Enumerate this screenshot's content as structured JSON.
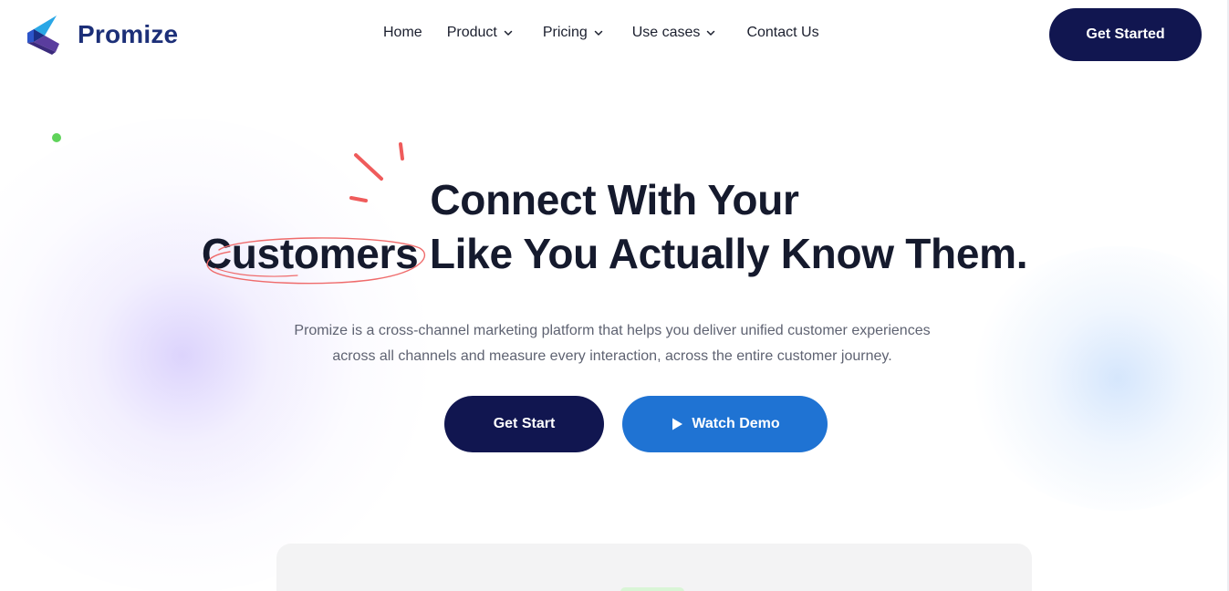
{
  "brand": {
    "name": "Promize",
    "color": "#1c2f78"
  },
  "nav": {
    "items": [
      {
        "label": "Home",
        "dropdown": false
      },
      {
        "label": "Product",
        "dropdown": true
      },
      {
        "label": "Pricing",
        "dropdown": true
      },
      {
        "label": "Use cases",
        "dropdown": true
      },
      {
        "label": "Contact Us",
        "dropdown": false
      }
    ],
    "cta_label": "Get Started"
  },
  "hero": {
    "title_line1": "Connect With Your",
    "title_line2": "Customers Like You Actually Know Them.",
    "subtitle_line1": "Promize is a cross-channel marketing platform that helps you deliver unified customer experiences",
    "subtitle_line2": "across all channels and measure every interaction, across the entire customer journey.",
    "primary_button": "Get Start",
    "secondary_button": "Watch Demo"
  },
  "colors": {
    "navy": "#111650",
    "blue": "#1f73d3",
    "accent_red": "#ef5b5b",
    "dot_green": "#5fd35a"
  },
  "icons": [
    "logo-mark-icon",
    "chevron-down-icon",
    "play-icon",
    "sparkle-lines-icon"
  ]
}
